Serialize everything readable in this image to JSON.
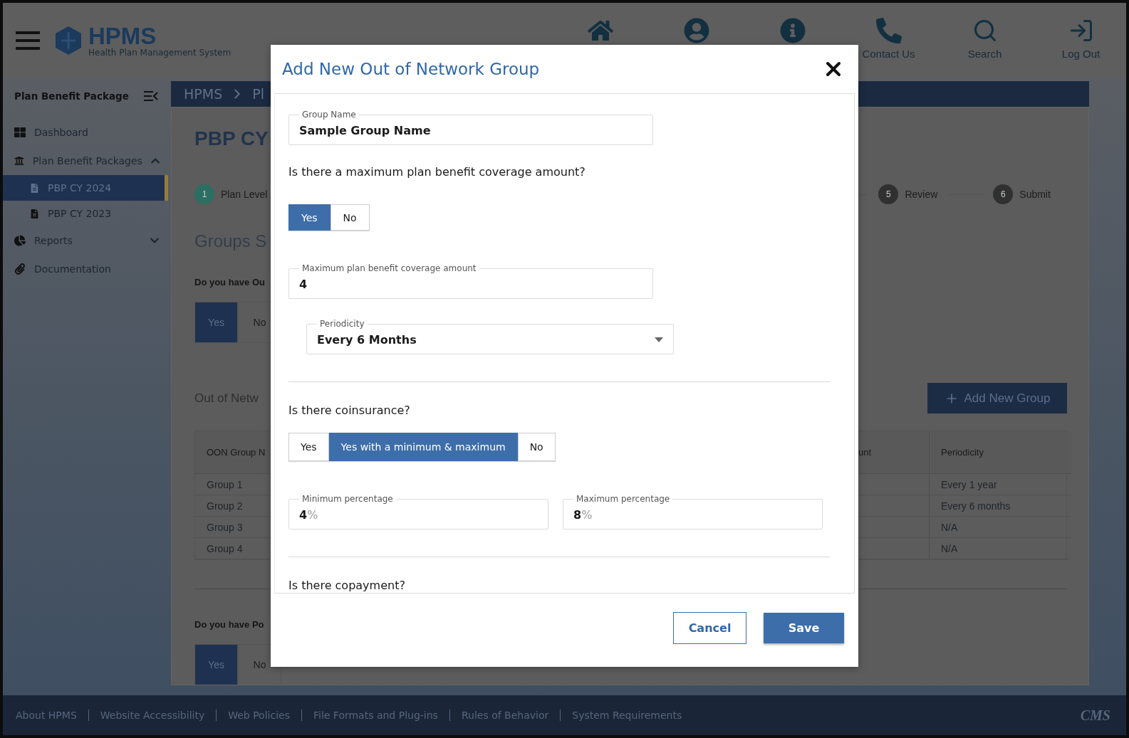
{
  "header": {
    "logo_title": "HPMS",
    "logo_subtitle": "Health Plan Management System",
    "nav": [
      {
        "label": "Contact Us"
      },
      {
        "label": "Search"
      },
      {
        "label": "Log Out"
      }
    ]
  },
  "sidebar": {
    "title": "Plan Benefit Package",
    "items": [
      {
        "label": "Dashboard"
      },
      {
        "label": "Plan Benefit Packages",
        "expanded": true,
        "children": [
          {
            "label": "PBP CY 2024",
            "selected": true
          },
          {
            "label": "PBP CY 2023",
            "selected": false
          }
        ]
      },
      {
        "label": "Reports",
        "expanded": false
      },
      {
        "label": "Documentation"
      }
    ]
  },
  "breadcrumb": [
    "HPMS",
    "Pl"
  ],
  "page": {
    "title": "PBP CY",
    "steps": [
      {
        "number": "1",
        "label": "Plan Level",
        "completed": true
      },
      {
        "number": "5",
        "label": "Review",
        "completed": false
      },
      {
        "number": "6",
        "label": "Submit",
        "completed": false
      }
    ],
    "groups_heading": "Groups S",
    "question_1": "Do you have Ou",
    "toggle_1": [
      {
        "label": "Yes",
        "selected": true
      },
      {
        "label": "No",
        "selected": false
      }
    ],
    "section_title": "Out of Netw",
    "add_button": "Add New Group",
    "table": {
      "columns": [
        "OON Group N",
        "unt",
        "Periodicity"
      ],
      "rows": [
        {
          "column_1": "Group 1",
          "periodicity": "Every 1 year"
        },
        {
          "column_1": "Group 2",
          "periodicity": "Every 6 months"
        },
        {
          "column_1": "Group 3",
          "periodicity": "N/A"
        },
        {
          "column_1": "Group 4",
          "periodicity": "N/A"
        }
      ]
    },
    "question_2": "Do you have Po",
    "toggle_2": [
      {
        "label": "Yes",
        "selected": true
      },
      {
        "label": "No",
        "selected": false
      }
    ]
  },
  "modal": {
    "title": "Add New Out of Network Group",
    "groups": [
      [
        {
          "kind": "field",
          "label": "Group Name",
          "value": "Sample Group Name"
        },
        {
          "kind": "question",
          "text": "Is there a maximum plan benefit coverage amount?"
        },
        {
          "kind": "toggle",
          "options": [
            {
              "label": "Yes",
              "selected": true
            },
            {
              "label": "No",
              "selected": false
            }
          ]
        },
        {
          "kind": "field",
          "label": "Maximum plan benefit coverage amount",
          "value": "4"
        },
        {
          "kind": "select",
          "label": "Periodicity",
          "value": "Every 6 Months"
        }
      ],
      [
        {
          "kind": "question",
          "text": "Is there coinsurance?"
        },
        {
          "kind": "toggle",
          "options": [
            {
              "label": "Yes",
              "selected": false
            },
            {
              "label": "Yes with a minimum & maximum",
              "selected": true
            },
            {
              "label": "No",
              "selected": false
            }
          ]
        },
        {
          "kind": "pair",
          "fields": [
            {
              "label": "Minimum percentage",
              "value": "4",
              "suffix": "%"
            },
            {
              "label": "Maximum percentage",
              "value": "8",
              "suffix": "%"
            }
          ]
        }
      ],
      [
        {
          "kind": "question",
          "text": "Is there copayment?"
        }
      ]
    ],
    "buttons": [
      {
        "label": "Cancel",
        "kind": "secondary"
      },
      {
        "label": "Save",
        "kind": "primary"
      }
    ]
  },
  "footer": {
    "links": [
      "About HPMS",
      "Website Accessibility",
      "Web Policies",
      "File Formats and Plug-ins",
      "Rules of Behavior",
      "System Requirements"
    ],
    "logo": "CMS"
  }
}
